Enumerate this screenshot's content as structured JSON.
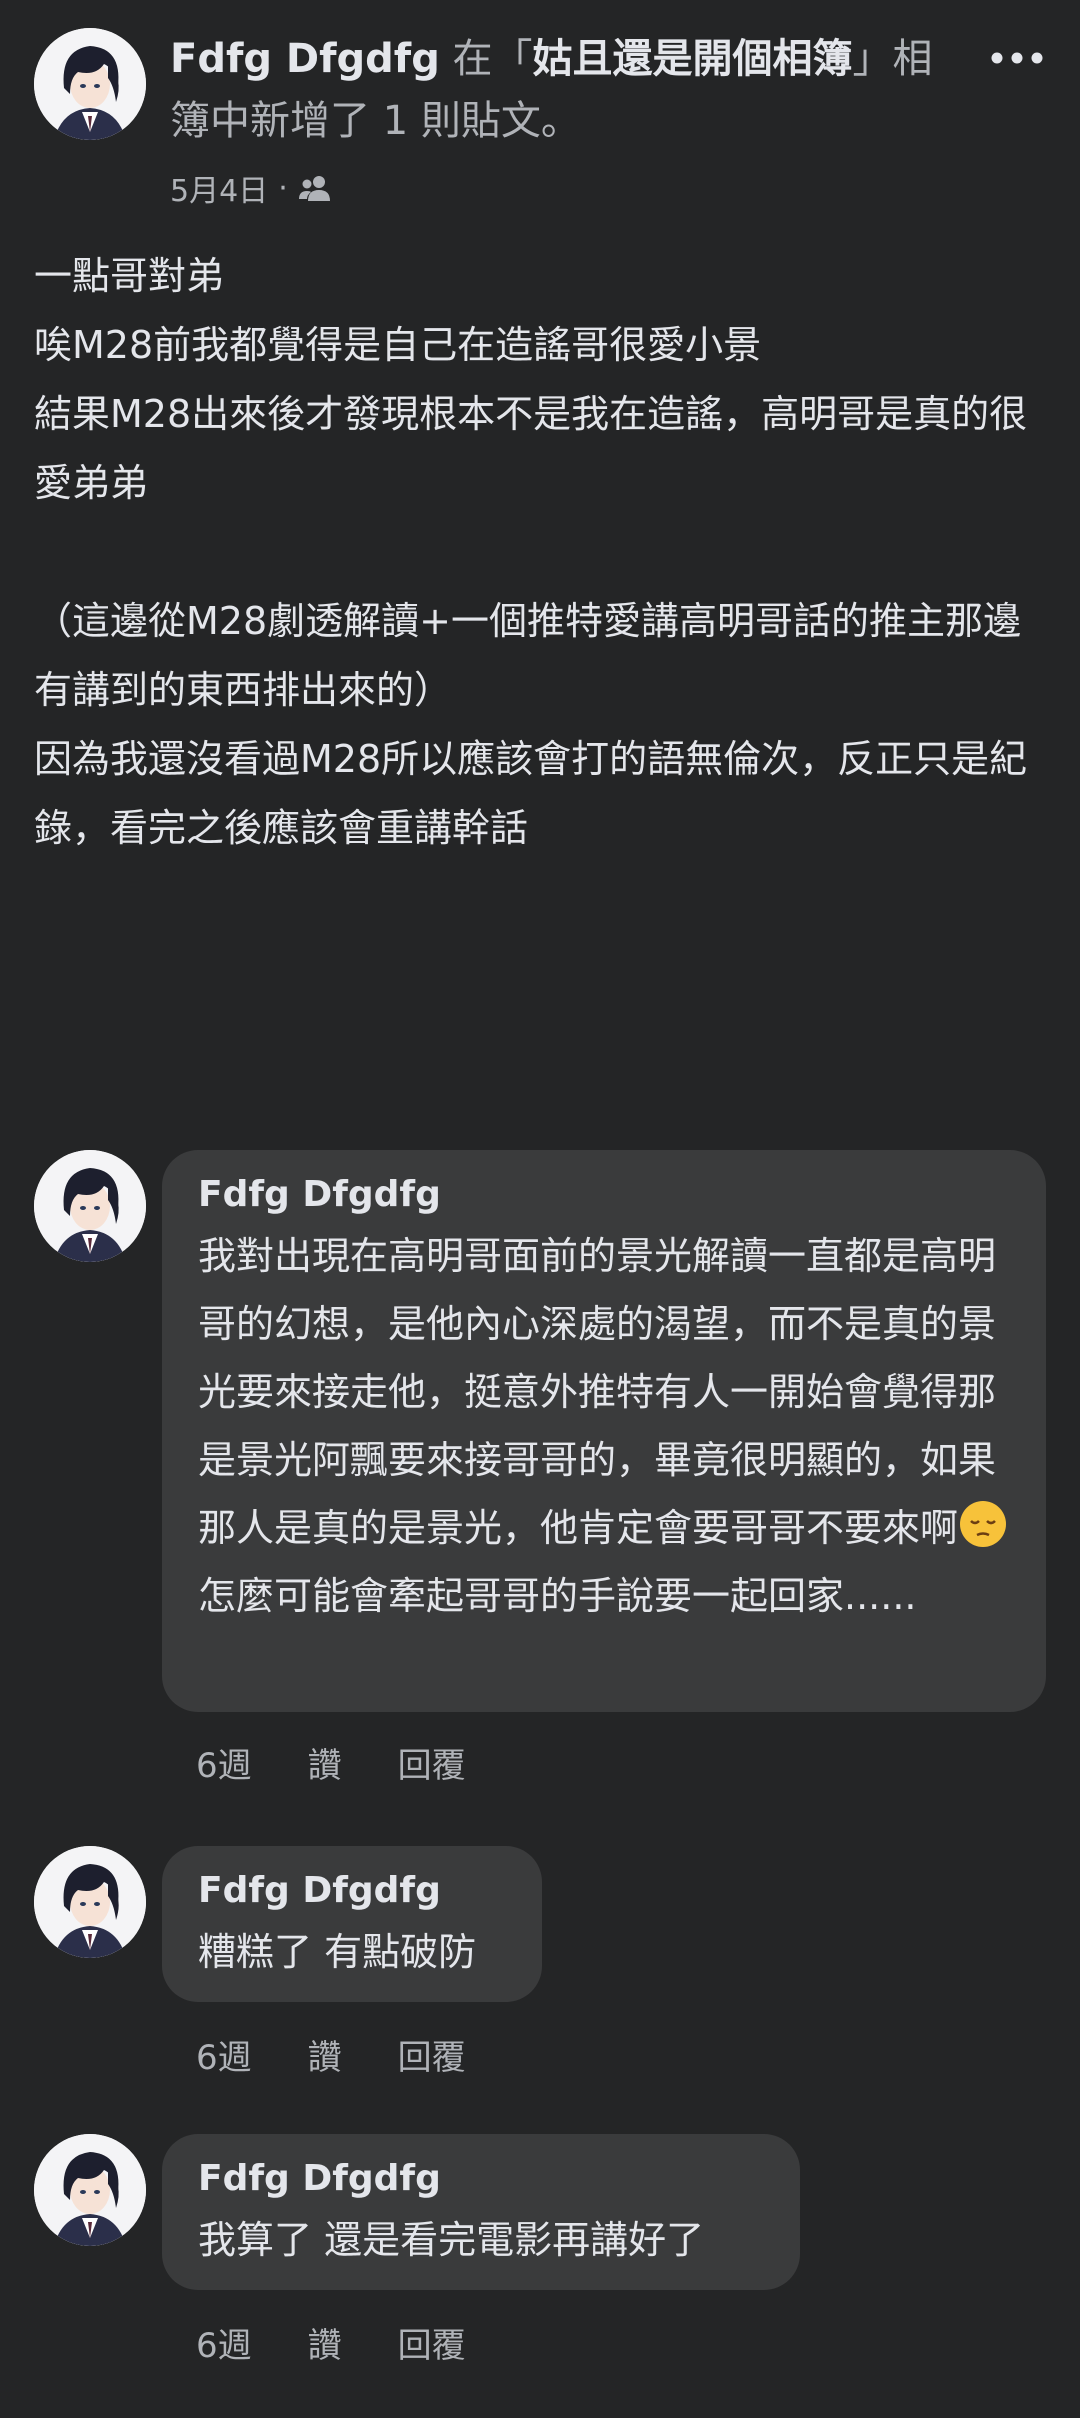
{
  "post": {
    "author": "Fdfg Dfgdfg",
    "action_prefix": " 在「",
    "album": "姑且還是開個相簿",
    "action_suffix": "」相簿中新增了 1 則貼文。",
    "date": "5月4日",
    "separator": "·",
    "audience_icon": "friends-icon",
    "more_icon": "more-options-icon",
    "body": [
      "一點哥對弟",
      "唉M28前我都覺得是自己在造謠哥很愛小景",
      "結果M28出來後才發現根本不是我在造謠，高明哥是真的很愛弟弟",
      "",
      "（這邊從M28劇透解讀+一個推特愛講高明哥話的推主那邊有講到的東西排出來的）",
      "因為我還沒看過M28所以應該會打的語無倫次，反正只是紀錄，看完之後應該會重講幹話"
    ]
  },
  "comments": [
    {
      "author": "Fdfg Dfgdfg",
      "text_before_emoji": "我對出現在高明哥面前的景光解讀一直都是高明哥的幻想，是他內心深處的渴望，而不是真的景光要來接走他，挺意外推特有人一開始會覺得那是景光阿飄要來接哥哥的，畢竟很明顯的，如果那人是真的是景光，他肯定會要哥哥不要來啊",
      "emoji": "pensive-face-emoji",
      "text_after_emoji": "怎麼可能會牽起哥哥的手說要一起回家......",
      "time": "6週",
      "like_label": "讚",
      "reply_label": "回覆"
    },
    {
      "author": "Fdfg Dfgdfg",
      "text": "糟糕了 有點破防",
      "time": "6週",
      "like_label": "讚",
      "reply_label": "回覆"
    },
    {
      "author": "Fdfg Dfgdfg",
      "text": "我算了 還是看完電影再講好了",
      "time": "6週",
      "like_label": "讚",
      "reply_label": "回覆"
    }
  ],
  "colors": {
    "background": "#242526",
    "bubble": "#3a3b3c",
    "primary_text": "#e4e6eb",
    "secondary_text": "#b0b3b8"
  }
}
